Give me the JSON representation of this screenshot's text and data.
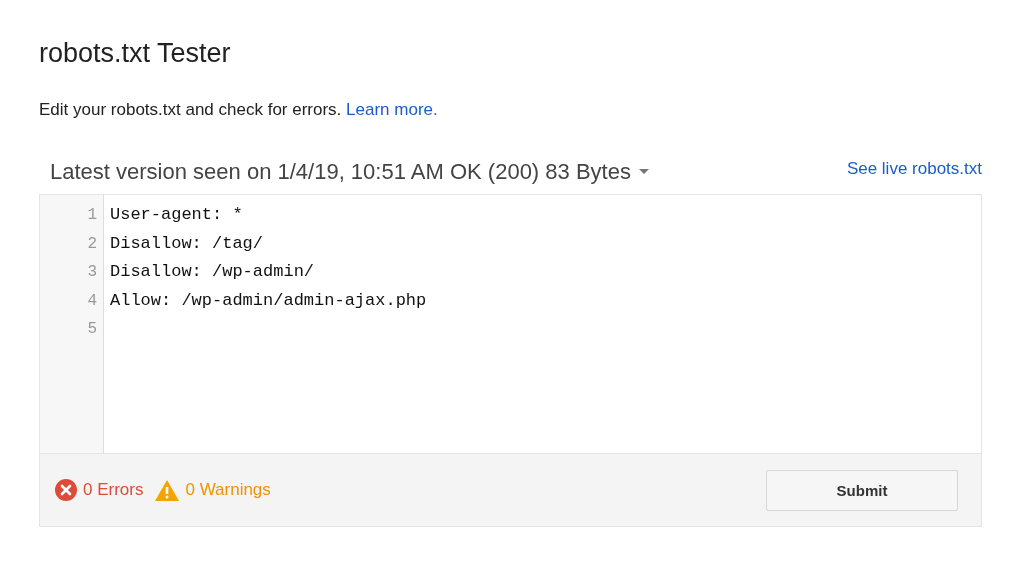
{
  "title": "robots.txt Tester",
  "intro": {
    "text": "Edit your robots.txt and check for errors.",
    "link": "Learn more."
  },
  "version": {
    "label": "Latest version seen on 1/4/19, 10:51 AM OK (200) 83 Bytes",
    "live_link": "See live robots.txt"
  },
  "editor": {
    "lines": [
      {
        "number": "1",
        "text": "User-agent: *"
      },
      {
        "number": "2",
        "text": "Disallow: /tag/"
      },
      {
        "number": "3",
        "text": "Disallow: /wp-admin/"
      },
      {
        "number": "4",
        "text": "Allow: /wp-admin/admin-ajax.php"
      },
      {
        "number": "5"
      }
    ]
  },
  "status": {
    "errors": "0 Errors",
    "warnings": "0 Warnings"
  },
  "buttons": [
    "Submit"
  ]
}
